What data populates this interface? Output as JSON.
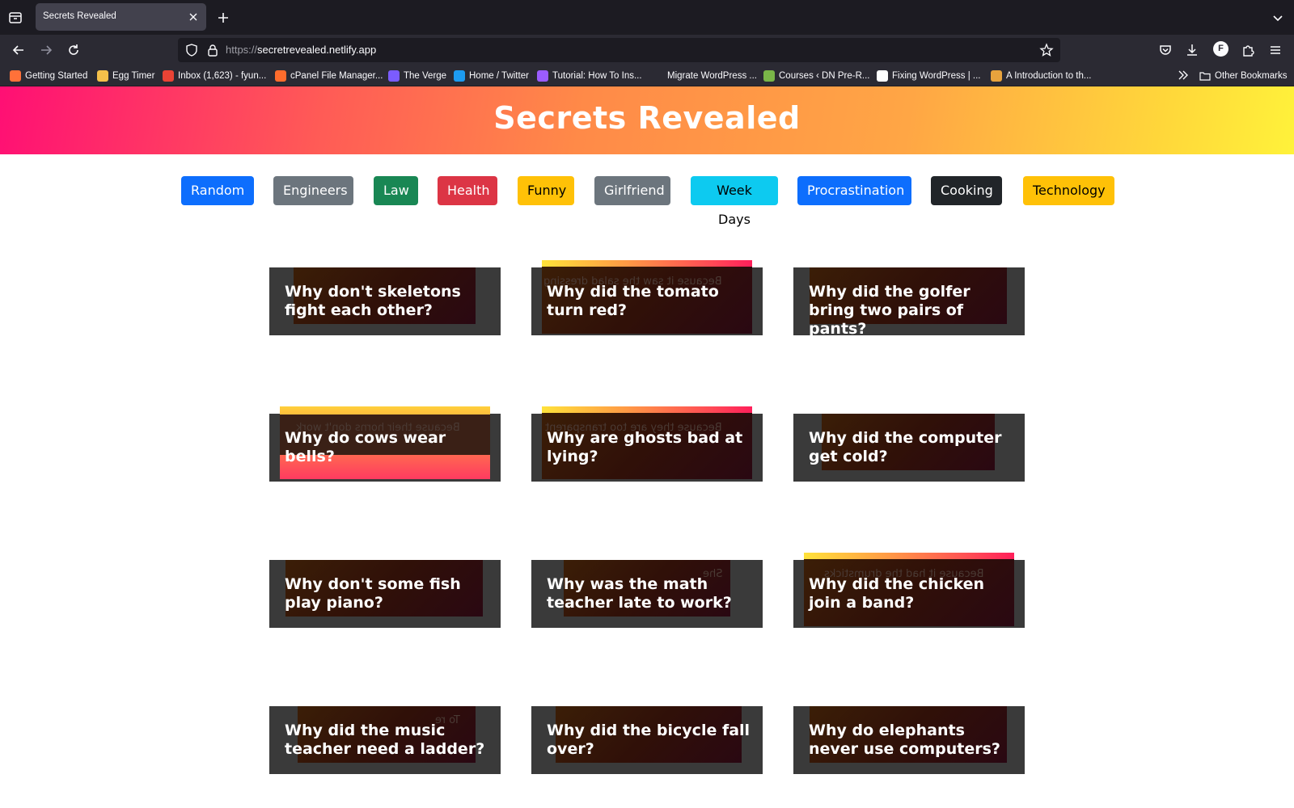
{
  "browser": {
    "tab_title": "Secrets Revealed",
    "url_scheme": "https://",
    "url_host": "secretrevealed.netlify.app",
    "profile_initial": "F",
    "bookmarks": [
      {
        "label": "Getting Started",
        "icon": "firefox-icon",
        "color": "#ff7139"
      },
      {
        "label": "Egg Timer",
        "icon": "egg-timer-icon",
        "color": "#f5c04a"
      },
      {
        "label": "Inbox (1,623) - fyun...",
        "icon": "gmail-icon",
        "color": "#ea4335"
      },
      {
        "label": "cPanel File Manager...",
        "icon": "cpanel-icon",
        "color": "#ff6c2c"
      },
      {
        "label": "The Verge",
        "icon": "verge-icon",
        "color": "#7b5cff"
      },
      {
        "label": "Home / Twitter",
        "icon": "twitter-icon",
        "color": "#1d9bf0"
      },
      {
        "label": "Tutorial: How To Ins...",
        "icon": "tutorial-icon",
        "color": "#9b5cff"
      },
      {
        "label": "Migrate WordPress ...",
        "icon": "hashnode-icon",
        "color": "#2b2a33"
      },
      {
        "label": "Courses ‹ DN Pre-R...",
        "icon": "dn-icon",
        "color": "#7ab648"
      },
      {
        "label": "Fixing WordPress | ...",
        "icon": "wordpress-icon",
        "color": "#ffffff"
      },
      {
        "label": "A Introduction to th...",
        "icon": "book-icon",
        "color": "#e8a33d"
      }
    ],
    "other_bookmarks": "Other Bookmarks"
  },
  "page": {
    "title": "Secrets Revealed"
  },
  "categories": [
    {
      "label": "Random",
      "bg": "#0d6efd",
      "fg": "#ffffff"
    },
    {
      "label": "Engineers",
      "bg": "#6c757d",
      "fg": "#ffffff"
    },
    {
      "label": "Law",
      "bg": "#198754",
      "fg": "#ffffff"
    },
    {
      "label": "Health",
      "bg": "#dc3545",
      "fg": "#ffffff"
    },
    {
      "label": "Funny",
      "bg": "#ffc107",
      "fg": "#000000"
    },
    {
      "label": "Girlfriend",
      "bg": "#6c757d",
      "fg": "#ffffff"
    },
    {
      "label": "Week Days",
      "bg": "#0dcaf0",
      "fg": "#000000"
    },
    {
      "label": "Procrastination",
      "bg": "#0d6efd",
      "fg": "#ffffff"
    },
    {
      "label": "Cooking",
      "bg": "#212529",
      "fg": "#ffffff"
    },
    {
      "label": "Technology",
      "bg": "#ffc107",
      "fg": "#000000"
    }
  ],
  "cards": [
    {
      "question": "Why don't skeletons fight each other?",
      "answer": ""
    },
    {
      "question": "Why did the tomato turn red?",
      "answer": "Because it saw the salad dressing"
    },
    {
      "question": "Why did the golfer bring two pairs of pants?",
      "answer": ""
    },
    {
      "question": "Why do cows wear bells?",
      "answer": "Because their horns don't work"
    },
    {
      "question": "Why are ghosts bad at lying?",
      "answer": "Because they are too transparent"
    },
    {
      "question": "Why did the computer get cold?",
      "answer": ""
    },
    {
      "question": "Why don't some fish play piano?",
      "answer": ""
    },
    {
      "question": "Why was the math teacher late to work?",
      "answer": "She"
    },
    {
      "question": "Why did the chicken join a band?",
      "answer": "Because it had the drumsticks"
    },
    {
      "question": "Why did the music teacher need a ladder?",
      "answer": "To re"
    },
    {
      "question": "Why did the bicycle fall over?",
      "answer": ""
    },
    {
      "question": "Why do elephants never use computers?",
      "answer": ""
    }
  ]
}
